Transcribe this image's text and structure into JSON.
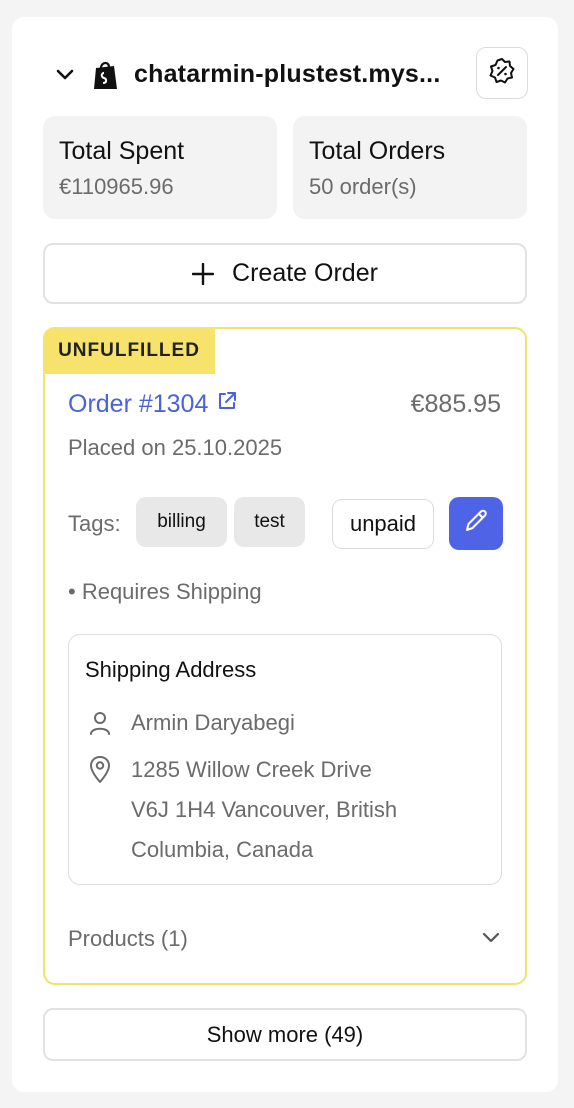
{
  "store": {
    "name": "chatarmin-plustest.mys..."
  },
  "stats": [
    {
      "label": "Total Spent",
      "value": "€110965.96"
    },
    {
      "label": "Total Orders",
      "value": "50 order(s)"
    }
  ],
  "create_order_label": "Create Order",
  "order": {
    "status": "UNFULFILLED",
    "number": "Order #1304",
    "total": "€885.95",
    "placed": "Placed on 25.10.2025",
    "tags_label": "Tags:",
    "tags": [
      "billing",
      "test"
    ],
    "payment_status": "unpaid",
    "requires_shipping": "• Requires Shipping",
    "shipping": {
      "title": "Shipping Address",
      "name": "Armin Daryabegi",
      "address_lines": [
        "1285 Willow Creek Drive",
        "V6J 1H4 Vancouver, British",
        "Columbia, Canada"
      ]
    },
    "products_label": "Products (1)"
  },
  "show_more_label": "Show more (49)",
  "colors": {
    "accent": "#4f63e6",
    "link": "#4a63d8",
    "badge": "#f7e36b",
    "card_border": "#f1e26a"
  }
}
